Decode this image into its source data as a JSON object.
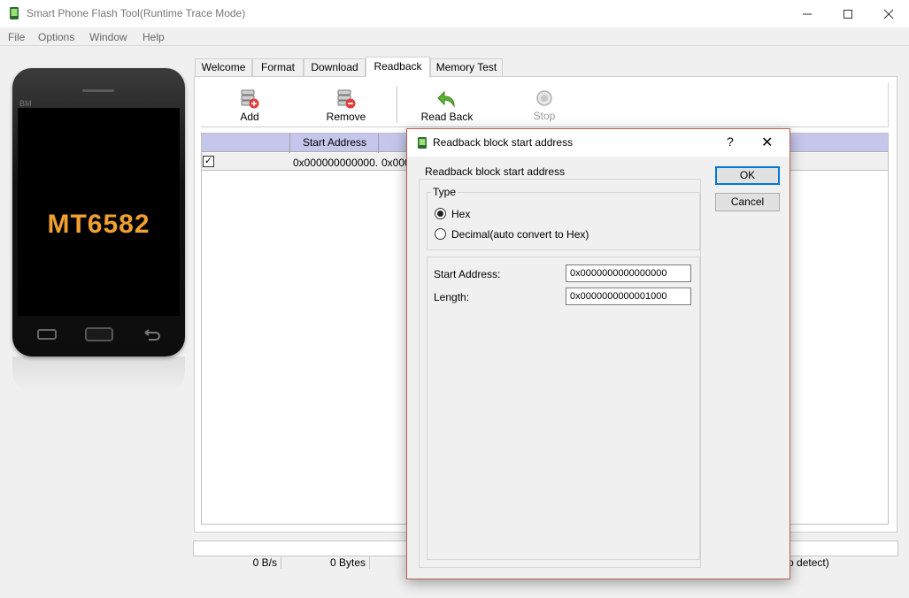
{
  "window": {
    "title": "Smart Phone Flash Tool(Runtime Trace Mode)",
    "controls": {
      "minimize": "–",
      "maximize": "☐",
      "close": "✕"
    }
  },
  "menu": [
    "File",
    "Options",
    "Window",
    "Help"
  ],
  "phone": {
    "brand": "BM",
    "chip": "MT6582"
  },
  "tabs": [
    "Welcome",
    "Format",
    "Download",
    "Readback",
    "Memory Test"
  ],
  "active_tab": "Readback",
  "toolbar": {
    "add": "Add",
    "remove": "Remove",
    "read_back": "Read Back",
    "stop": "Stop"
  },
  "table": {
    "headers": [
      "",
      "Start Address"
    ],
    "row": {
      "checked": "✓",
      "start_address": "0x000000000000...",
      "next_cell": "0x000"
    }
  },
  "status": {
    "speed": "0 B/s",
    "bytes": "0 Bytes",
    "detect": "uto detect)"
  },
  "dialog": {
    "title": "Readback block start address",
    "help": "?",
    "close": "✕",
    "group_label": "Readback block start address",
    "type_label": "Type",
    "radio_hex": "Hex",
    "radio_decimal": "Decimal(auto convert to Hex)",
    "selected_type": "Hex",
    "start_address_label": "Start Address:",
    "start_address_value": "0x0000000000000000",
    "length_label": "Length:",
    "length_value": "0x0000000000001000",
    "ok": "OK",
    "cancel": "Cancel"
  },
  "colors": {
    "grid_header": "#c6c6ec",
    "chip_text": "#f0a030",
    "dialog_border": "#b55f4e",
    "default_button_border": "#0078d7"
  }
}
